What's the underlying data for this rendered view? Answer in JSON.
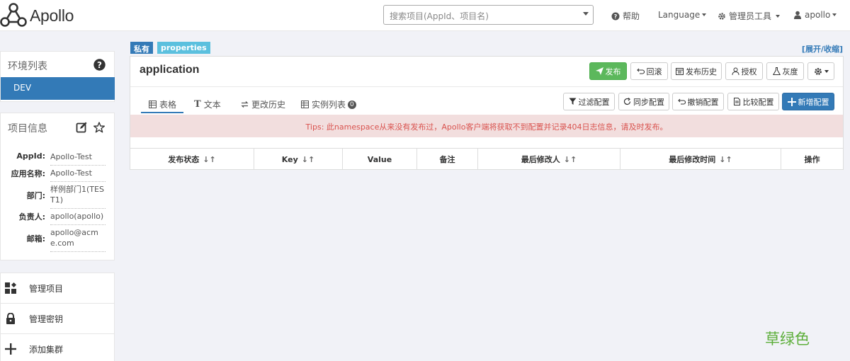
{
  "app": {
    "name": "Apollo"
  },
  "navbar": {
    "search_placeholder": "搜索项目(AppId、项目名)",
    "help": "帮助",
    "language": "Language",
    "admin_tools": "管理员工具",
    "user": "apollo"
  },
  "sidebar": {
    "env_title": "环境列表",
    "env_active": "DEV",
    "info_title": "项目信息",
    "info": [
      {
        "label": "AppId:",
        "value": "Apollo-Test"
      },
      {
        "label": "应用名称:",
        "value": "Apollo-Test"
      },
      {
        "label": "部门:",
        "value": "样例部门1(TEST1)"
      },
      {
        "label": "负责人:",
        "value": "apollo(apollo)"
      },
      {
        "label": "邮箱:",
        "value": "apollo@acme.com"
      }
    ],
    "menu": [
      {
        "label": "管理项目",
        "icon": "grid-icon"
      },
      {
        "label": "管理密钥",
        "icon": "lock-icon"
      },
      {
        "label": "添加集群",
        "icon": "plus-icon"
      }
    ]
  },
  "namespace": {
    "tag_private": "私有",
    "tag_format": "properties",
    "expand_collapse": "[展开/收缩]",
    "title": "application",
    "actions": {
      "publish": "发布",
      "rollback": "回滚",
      "history": "发布历史",
      "grant": "授权",
      "gray": "灰度"
    },
    "tabs": {
      "table": "表格",
      "text": "文本",
      "change_history": "更改历史",
      "instances": "实例列表",
      "instances_count": "0"
    },
    "tools": {
      "filter": "过滤配置",
      "sync": "同步配置",
      "revoke": "撤销配置",
      "compare": "比较配置",
      "add": "新增配置"
    },
    "tips": "Tips: 此namespace从来没有发布过，Apollo客户端将获取不到配置并记录404日志信息，请及时发布。",
    "columns": [
      "发布状态",
      "Key",
      "Value",
      "备注",
      "最后修改人",
      "最后修改时间",
      "操作"
    ],
    "sort_glyph": "↓↑"
  },
  "footer_note": "草绿色",
  "colors": {
    "primary": "#337ab7",
    "success": "#5cb85c",
    "danger": "#d9534f",
    "info": "#5bc0de"
  }
}
